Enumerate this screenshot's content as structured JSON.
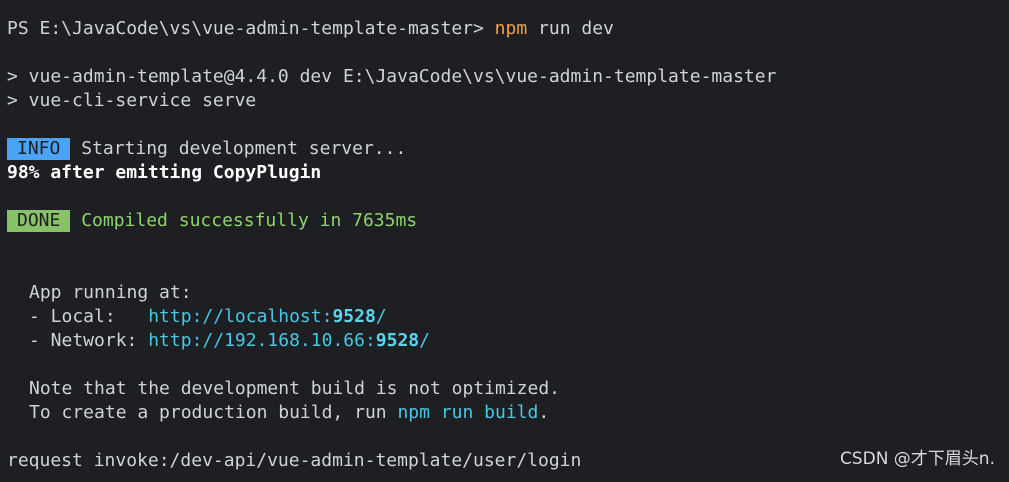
{
  "terminal": {
    "prompt": "PS E:\\JavaCode\\vs\\vue-admin-template-master>",
    "command": "npm",
    "command_rest": "run dev",
    "script_line_1": "> vue-admin-template@4.4.0 dev E:\\JavaCode\\vs\\vue-admin-template-master",
    "script_line_2": "> vue-cli-service serve",
    "info_tag": "INFO",
    "info_text": "Starting development server...",
    "progress_text": "98% after emitting CopyPlugin",
    "done_tag": "DONE",
    "done_text": "Compiled successfully in 7635ms",
    "app_running": "App running at:",
    "local_label": "- Local:",
    "local_url_base": "http://localhost:",
    "local_port": "9528",
    "local_suffix": "/",
    "network_label": "- Network:",
    "network_url_base": "http://192.168.10.66:",
    "network_port": "9528",
    "network_suffix": "/",
    "note_line_1": "Note that the development build is not optimized.",
    "note_line_2_prefix": "To create a production build, run",
    "note_line_2_command": "npm run build",
    "note_line_2_suffix": ".",
    "request_line": "request invoke:/dev-api/vue-admin-template/user/login"
  },
  "watermark": {
    "text": "CSDN @才下眉头n."
  },
  "colors": {
    "background": "#1e1f22",
    "text": "#cfd3d8",
    "command": "#f0a14a",
    "info": "#4aa3f5",
    "done": "#88c168",
    "success": "#8ed46b",
    "link": "#48c7e4"
  }
}
